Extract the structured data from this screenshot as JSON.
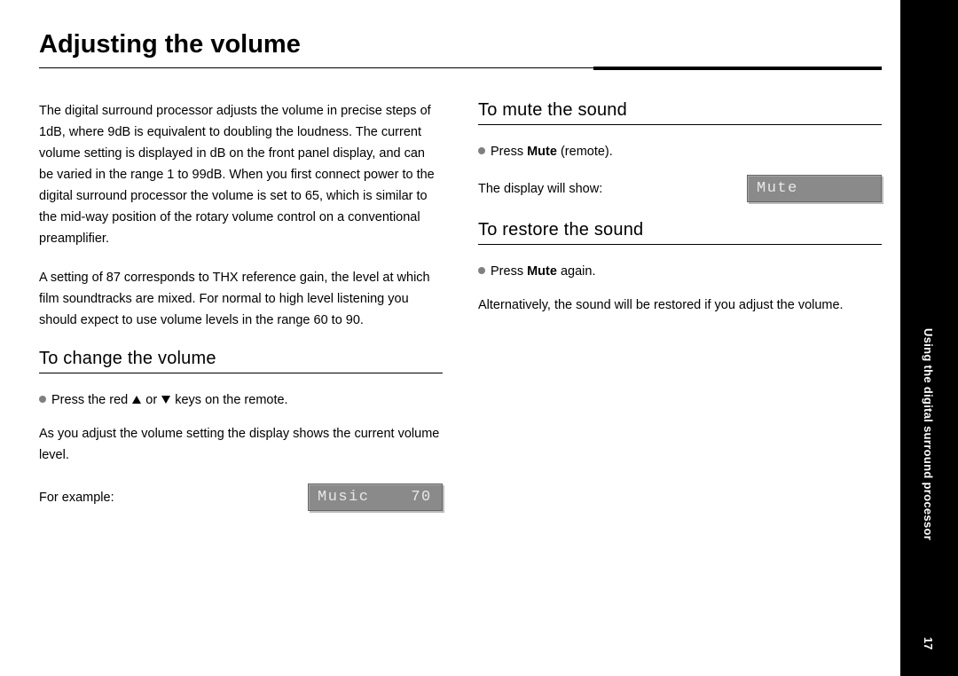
{
  "sidebar": {
    "section": "Using the digital surround processor",
    "page_number": "17"
  },
  "title": "Adjusting the volume",
  "intro_paragraphs": [
    "The digital surround processor adjusts the volume in precise steps of 1dB, where 9dB is equivalent to doubling the loudness. The current volume setting is displayed in dB on the front panel display, and can be varied in the range 1 to 99dB. When you first connect power to the digital surround processor the volume is set to 65, which is similar to the mid-way position of the rotary volume control on a conventional preamplifier.",
    "A setting of 87 corresponds to THX reference gain, the level at which film soundtracks are mixed. For normal to high level listening you should expect to use volume levels in the range 60 to 90."
  ],
  "section_change": {
    "heading": "To change the volume",
    "bullet_prefix": "Press the red ",
    "bullet_mid": " or ",
    "bullet_suffix": " keys on the remote.",
    "para": "As you adjust the volume setting the display shows the current volume level.",
    "example_label": "For example:",
    "lcd": "Music    70"
  },
  "section_mute": {
    "heading": "To mute the sound",
    "bullet_prefix": "Press ",
    "bullet_bold": "Mute",
    "bullet_suffix": " (remote).",
    "display_label": "The display will show:",
    "lcd": "Mute"
  },
  "section_restore": {
    "heading": "To restore the sound",
    "bullet_prefix": "Press ",
    "bullet_bold": "Mute",
    "bullet_suffix": " again.",
    "para": "Alternatively, the sound will be restored if you adjust the volume."
  }
}
